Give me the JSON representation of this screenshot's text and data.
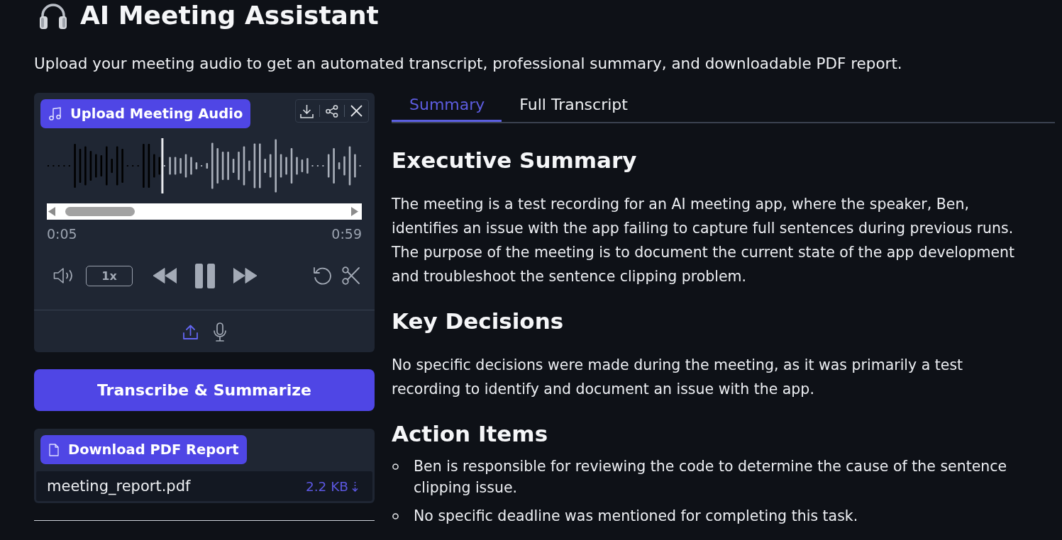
{
  "header": {
    "title": "AI Meeting Assistant",
    "subtitle": "Upload your meeting audio to get an automated transcript, professional summary, and downloadable PDF report."
  },
  "audio_panel": {
    "upload_button": "Upload Meeting Audio",
    "waveform": {
      "level": 0.367
    },
    "current_time": "0:05",
    "duration": "0:59",
    "speed": "1x",
    "playing": true,
    "sources": [
      {
        "kind": "upload",
        "selected": true
      },
      {
        "kind": "microphone",
        "selected": false
      }
    ]
  },
  "transcribe_button": "Transcribe & Summarize",
  "download_panel": {
    "button": "Download PDF Report",
    "file_name": "meeting_report.pdf",
    "file_size": "2.2 KB"
  },
  "tabs": [
    {
      "label": "Summary",
      "selected": true
    },
    {
      "label": "Full Transcript",
      "selected": false
    }
  ],
  "sections": [
    {
      "kind": "paragraph",
      "heading": "Executive Summary",
      "text": "The meeting is a test recording for an AI meeting app, where the speaker, Ben, identifies an issue with the app failing to capture full sentences during previous runs. The purpose of the meeting is to document the current state of the app development and troubleshoot the sentence clipping problem."
    },
    {
      "kind": "paragraph",
      "heading": "Key Decisions",
      "text": "No specific decisions were made during the meeting, as it was primarily a test recording to identify and document an issue with the app."
    },
    {
      "kind": "list",
      "heading": "Action Items",
      "items": [
        "Ben is responsible for reviewing the code to determine the cause of the sentence clipping issue.",
        "No specific deadline was mentioned for completing this task."
      ]
    }
  ]
}
